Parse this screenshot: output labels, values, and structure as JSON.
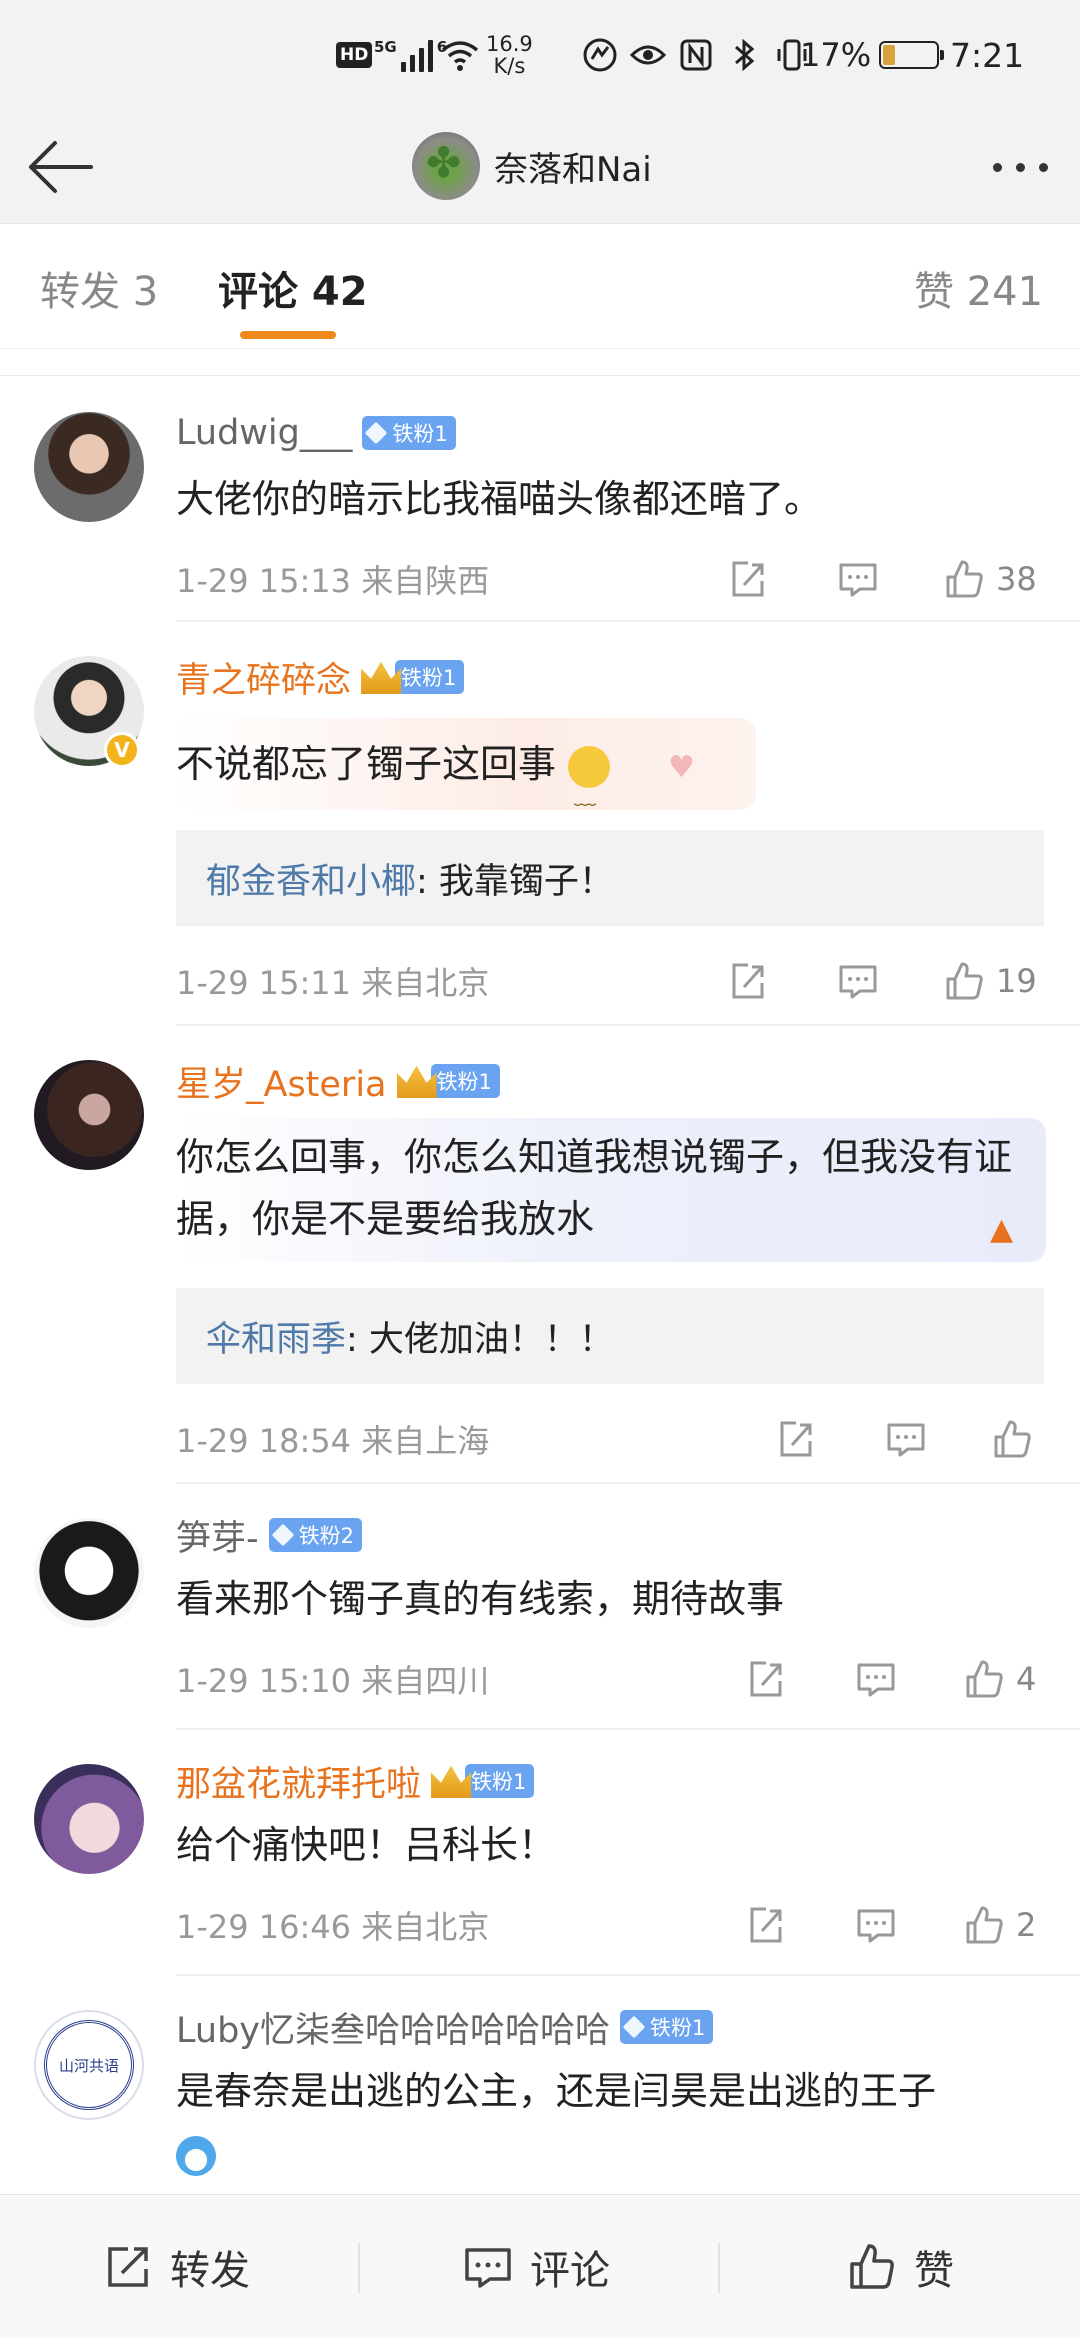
{
  "status_bar": {
    "hd": "HD",
    "network": "5G",
    "signal_2": "6",
    "speed_value": "16.9",
    "speed_unit": "K/s",
    "battery_percent": "17%",
    "time": "7:21"
  },
  "nav": {
    "title": "奈落和Nai"
  },
  "tabs": {
    "repost": "转发 3",
    "comment": "评论 42",
    "like": "赞 241"
  },
  "comments": [
    {
      "user": "Ludwig___",
      "badge": "铁粉1",
      "text": "大佬你的暗示比我福喵头像都还暗了。",
      "meta": "1-29 15:13 来自陕西",
      "likes": "38"
    },
    {
      "user": "青之碎碎念",
      "badge": "铁粉1",
      "text": "不说都忘了镯子这回事",
      "reply_user": "郁金香和小椰",
      "reply_text": ": 我靠镯子！",
      "meta": "1-29 15:11 来自北京",
      "likes": "19"
    },
    {
      "user": "星岁_Asteria",
      "badge": "铁粉1",
      "text": "你怎么回事，你怎么知道我想说镯子，但我没有证据，你是不是要给我放水",
      "reply_user": "伞和雨季",
      "reply_text": ": 大佬加油！！！",
      "meta": "1-29 18:54 来自上海",
      "likes": ""
    },
    {
      "user": "笋芽-",
      "badge": "铁粉2",
      "text": "看来那个镯子真的有线索，期待故事",
      "meta": "1-29 15:10 来自四川",
      "likes": "4"
    },
    {
      "user": "那盆花就拜托啦",
      "badge": "铁粉1",
      "text": "给个痛快吧！吕科长！",
      "meta": "1-29 16:46 来自北京",
      "likes": "2"
    },
    {
      "user": "Luby忆柒叁哈哈哈哈哈哈哈",
      "badge": "铁粉1",
      "text": "是春奈是出逃的公主，还是闫昊是出逃的王子",
      "avatar_text": "山河共语"
    }
  ],
  "bottom_bar": {
    "repost": "转发",
    "comment": "评论",
    "like": "赞"
  },
  "colors": {
    "accent": "#f08a1c",
    "vip_name": "#e8731e",
    "badge": "#6aa4f0",
    "reply_name": "#4f79a8"
  },
  "icons": [
    "back-arrow-icon",
    "more-dots-icon",
    "share-icon",
    "comment-icon",
    "like-icon",
    "wifi-icon",
    "bluetooth-icon",
    "nfc-icon",
    "eye-icon",
    "vibrate-icon",
    "battery-icon"
  ]
}
